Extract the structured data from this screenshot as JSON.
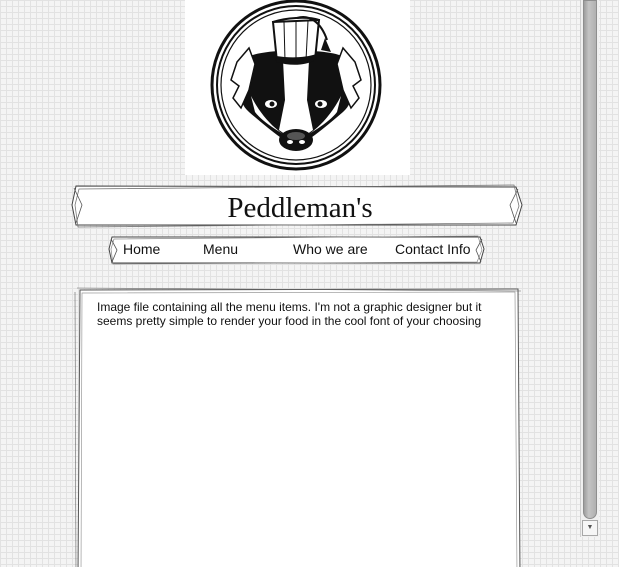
{
  "site": {
    "title": "Peddleman's",
    "logo_icon": "badger-with-fez-icon"
  },
  "nav": {
    "items": [
      {
        "label": "Home"
      },
      {
        "label": "Menu"
      },
      {
        "label": "Who we are"
      },
      {
        "label": "Contact Info"
      }
    ]
  },
  "content": {
    "text": "Image file containing all the menu items. I'm not a graphic designer but it seems pretty simple to render your food in the cool font of your choosing"
  },
  "scrollbar": {
    "arrow_icon": "scroll-down-arrow-icon"
  },
  "colors": {
    "ink": "#111111",
    "paper": "#ffffff",
    "grid": "#e2e2e2"
  }
}
